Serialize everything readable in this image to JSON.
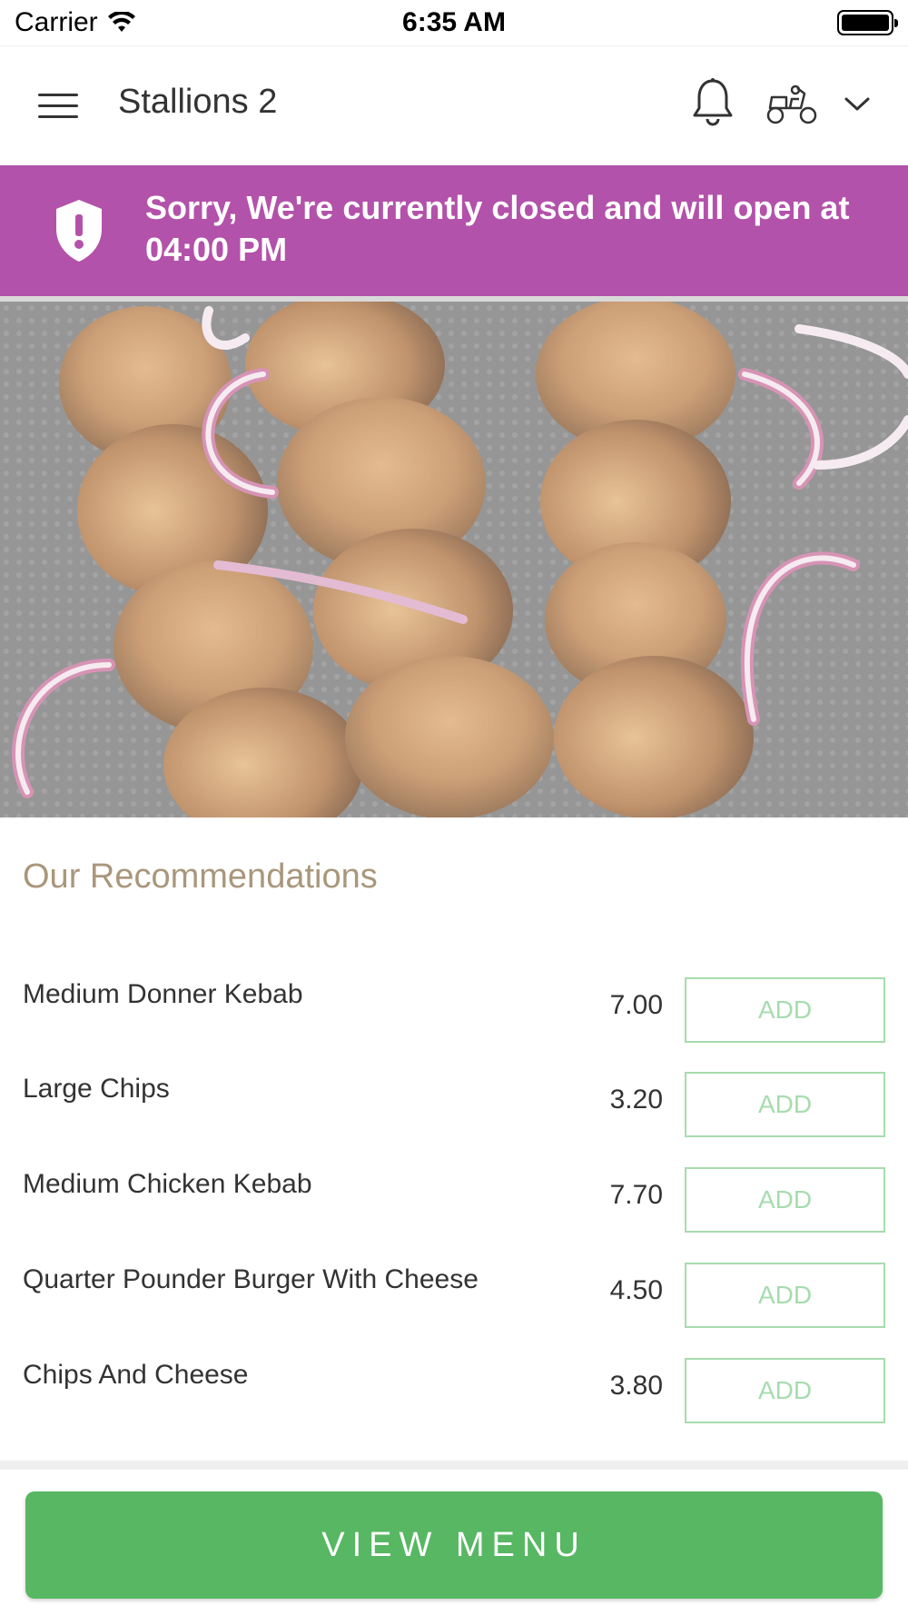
{
  "status_bar": {
    "carrier": "Carrier",
    "time": "6:35 AM"
  },
  "header": {
    "title": "Stallions 2",
    "icons": [
      "menu-icon",
      "bell-icon",
      "delivery-scooter-icon",
      "chevron-down-icon"
    ]
  },
  "closed_banner": {
    "message": "Sorry, We're currently closed and will open at 04:00 PM",
    "icon": "shield-alert-icon",
    "color": "#b352aa"
  },
  "hero": {
    "description_icon": "food-image"
  },
  "recommendations": {
    "title": "Our Recommendations",
    "items": [
      {
        "name": "Medium Donner Kebab",
        "price": "7.00",
        "button": "ADD"
      },
      {
        "name": "Large Chips",
        "price": "3.20",
        "button": "ADD"
      },
      {
        "name": "Medium Chicken Kebab",
        "price": "7.70",
        "button": "ADD"
      },
      {
        "name": "Quarter Pounder Burger With Cheese",
        "price": "4.50",
        "button": "ADD"
      },
      {
        "name": "Chips And Cheese",
        "price": "3.80",
        "button": "ADD"
      }
    ]
  },
  "footer": {
    "view_menu_label": "VIEW MENU",
    "accent_color": "#57b762"
  }
}
